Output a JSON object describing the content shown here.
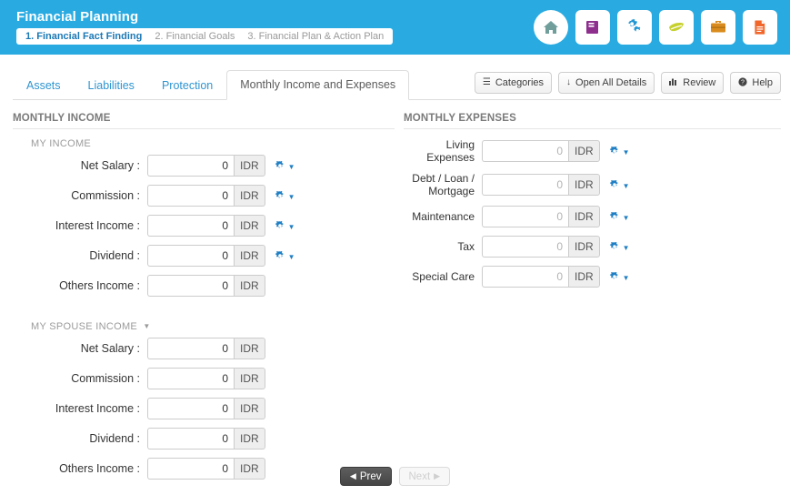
{
  "header": {
    "title": "Financial Planning",
    "steps": [
      {
        "label": "1. Financial Fact Finding",
        "active": true
      },
      {
        "label": "2. Financial Goals",
        "active": false
      },
      {
        "label": "3. Financial Plan & Action Plan",
        "active": false
      }
    ],
    "icons": [
      {
        "name": "home-icon",
        "color": "#6f9e9b"
      },
      {
        "name": "book-icon",
        "color": "#8e2f8e"
      },
      {
        "name": "gears-icon",
        "color": "#2196d3"
      },
      {
        "name": "leaf-icon",
        "color": "#c6d12e"
      },
      {
        "name": "briefcase-icon",
        "color": "#d98c1d"
      },
      {
        "name": "document-icon",
        "color": "#f0662b"
      }
    ],
    "accent_color": "#29abe2"
  },
  "tabs": [
    {
      "label": "Assets",
      "active": false
    },
    {
      "label": "Liabilities",
      "active": false
    },
    {
      "label": "Protection",
      "active": false
    },
    {
      "label": "Monthly Income and Expenses",
      "active": true
    }
  ],
  "toolbar": [
    {
      "label": "Categories",
      "icon": "list-icon",
      "glyph": "☰"
    },
    {
      "label": "Open All Details",
      "icon": "arrow-down-icon",
      "glyph": "↓"
    },
    {
      "label": "Review",
      "icon": "chart-bar-icon",
      "glyph": "ὌA"
    },
    {
      "label": "Help",
      "icon": "question-circle-icon",
      "glyph": "?"
    }
  ],
  "income": {
    "section_title": "MONTHLY INCOME",
    "groups": [
      {
        "title": "MY INCOME",
        "collapsible": false,
        "rows": [
          {
            "label": "Net Salary :",
            "value": "0",
            "currency": "IDR",
            "gear": true
          },
          {
            "label": "Commission :",
            "value": "0",
            "currency": "IDR",
            "gear": true
          },
          {
            "label": "Interest Income :",
            "value": "0",
            "currency": "IDR",
            "gear": true
          },
          {
            "label": "Dividend :",
            "value": "0",
            "currency": "IDR",
            "gear": true
          },
          {
            "label": "Others Income :",
            "value": "0",
            "currency": "IDR",
            "gear": false
          }
        ]
      },
      {
        "title": "MY SPOUSE INCOME",
        "collapsible": true,
        "rows": [
          {
            "label": "Net Salary :",
            "value": "0",
            "currency": "IDR",
            "gear": false
          },
          {
            "label": "Commission :",
            "value": "0",
            "currency": "IDR",
            "gear": false
          },
          {
            "label": "Interest Income :",
            "value": "0",
            "currency": "IDR",
            "gear": false
          },
          {
            "label": "Dividend :",
            "value": "0",
            "currency": "IDR",
            "gear": false
          },
          {
            "label": "Others Income :",
            "value": "0",
            "currency": "IDR",
            "gear": false
          }
        ]
      }
    ]
  },
  "expenses": {
    "section_title": "MONTHLY EXPENSES",
    "rows": [
      {
        "label": "Living Expenses",
        "value": "0",
        "currency": "IDR",
        "gear": true,
        "muted": true
      },
      {
        "label": "Debt / Loan / Mortgage",
        "value": "0",
        "currency": "IDR",
        "gear": true,
        "muted": true
      },
      {
        "label": "Maintenance",
        "value": "0",
        "currency": "IDR",
        "gear": true,
        "muted": true
      },
      {
        "label": "Tax",
        "value": "0",
        "currency": "IDR",
        "gear": true,
        "muted": true
      },
      {
        "label": "Special Care",
        "value": "0",
        "currency": "IDR",
        "gear": true,
        "muted": true
      }
    ]
  },
  "footer": {
    "prev_label": "Prev",
    "next_label": "Next",
    "next_disabled": true
  }
}
